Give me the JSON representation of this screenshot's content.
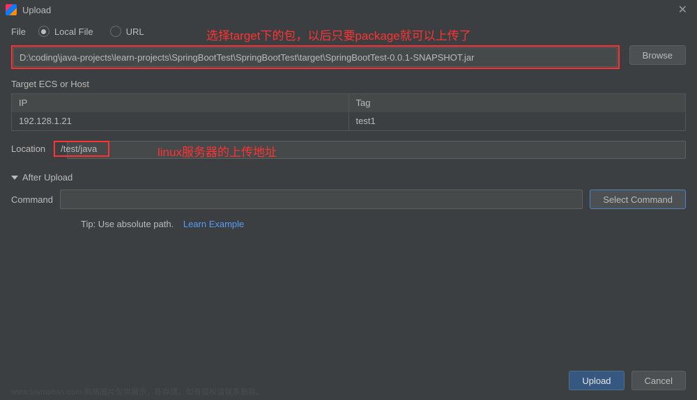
{
  "titlebar": {
    "title": "Upload"
  },
  "file": {
    "label": "File",
    "radio_local": "Local File",
    "radio_url": "URL",
    "path_value": "D:\\coding\\java-projects\\learn-projects\\SpringBootTest\\SpringBootTest\\target\\SpringBootTest-0.0.1-SNAPSHOT.jar",
    "browse_label": "Browse"
  },
  "annotations": {
    "top": "选择target下的包，以后只要package就可以上传了",
    "mid": "linux服务器的上传地址"
  },
  "target": {
    "section_label": "Target ECS or Host",
    "header_ip": "IP",
    "header_tag": "Tag",
    "row_ip": "192.128.1.21",
    "row_tag": "test1"
  },
  "location": {
    "label": "Location",
    "value": "/test/java"
  },
  "after_upload": {
    "header": "After Upload",
    "command_label": "Command",
    "select_command_label": "Select Command",
    "tip_prefix": "Tip: Use absolute path.",
    "tip_link": "Learn Example"
  },
  "footer": {
    "upload": "Upload",
    "cancel": "Cancel"
  },
  "watermark": "www.toymoban.com 网络图片仅供展示，非存储，如有侵权请联系删除。"
}
